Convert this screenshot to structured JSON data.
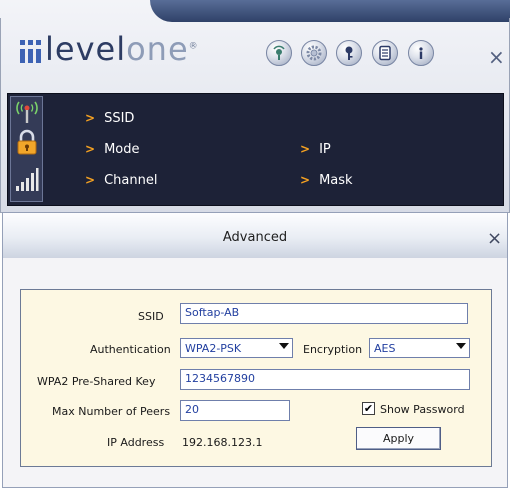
{
  "app": {
    "brand": {
      "part1": "level",
      "part2": "one",
      "mark": "®"
    },
    "toolbar": [
      {
        "id": "wps",
        "icon": "wps-icon"
      },
      {
        "id": "settings",
        "icon": "gear-icon"
      },
      {
        "id": "security",
        "icon": "key-icon"
      },
      {
        "id": "profile",
        "icon": "document-icon"
      },
      {
        "id": "about",
        "icon": "info-icon"
      }
    ],
    "close_label": "×"
  },
  "info_panel": {
    "rows": [
      {
        "label": "SSID"
      },
      {
        "label": "Mode"
      },
      {
        "label": "Channel"
      },
      {
        "label": "IP"
      },
      {
        "label": "Mask"
      }
    ],
    "status_icons": [
      "signal-tower-icon",
      "padlock-icon",
      "signal-strength-icon"
    ]
  },
  "advanced": {
    "title": "Advanced",
    "close_label": "×",
    "ssid": {
      "label": "SSID",
      "value": "Softap-AB"
    },
    "authentication": {
      "label": "Authentication",
      "value": "WPA2-PSK"
    },
    "encryption": {
      "label": "Encryption",
      "value": "AES"
    },
    "psk": {
      "label": "WPA2 Pre-Shared Key",
      "value": "1234567890"
    },
    "max_peers": {
      "label": "Max Number of Peers",
      "value": "20"
    },
    "show_password": {
      "label": "Show Password",
      "checked": true,
      "mark": "✔"
    },
    "ip_address": {
      "label": "IP Address",
      "value": "192.168.123.1"
    },
    "apply_label": "Apply"
  },
  "colors": {
    "accent_orange": "#f6a221",
    "panel_dark": "#1d2237",
    "form_bg": "#fdf8e3",
    "field_text": "#2340a0"
  }
}
